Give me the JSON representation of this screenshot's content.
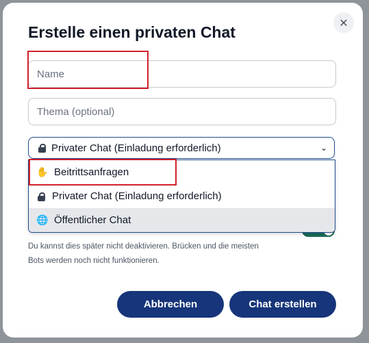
{
  "dialog": {
    "title": "Erstelle einen privaten Chat",
    "close_label": "✕"
  },
  "form": {
    "name_placeholder": "Name",
    "topic_placeholder": "Thema (optional)",
    "visibility": {
      "selected": "Privater Chat (Einladung erforderlich)",
      "options": [
        {
          "label": "Beitrittsanfragen",
          "icon": "hand-icon"
        },
        {
          "label": "Privater Chat (Einladung erforderlich)",
          "icon": "lock-icon"
        },
        {
          "label": "Öffentlicher Chat",
          "icon": "globe-icon"
        }
      ]
    },
    "encryption_toggle_on": true,
    "hint": "Du kannst dies später nicht deaktivieren. Brücken und die meisten Bots werden noch nicht funktionieren."
  },
  "actions": {
    "cancel": "Abbrechen",
    "create": "Chat erstellen"
  },
  "colors": {
    "primary": "#16357a",
    "toggle": "#1a6b5a",
    "highlight": "#d0202a"
  }
}
